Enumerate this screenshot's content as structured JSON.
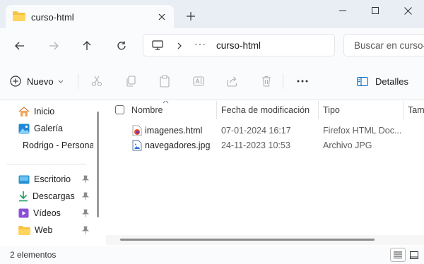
{
  "window": {
    "tab_title": "curso-html",
    "new_tab_symbol": "+"
  },
  "address": {
    "overflow": "···",
    "path": "curso-html"
  },
  "search": {
    "placeholder": "Buscar en curso-html"
  },
  "toolbar": {
    "new_label": "Nuevo",
    "details_label": "Detalles",
    "more": "···"
  },
  "sidebar": {
    "items": [
      {
        "label": "Inicio",
        "icon": "home-icon",
        "pinned": false
      },
      {
        "label": "Galería",
        "icon": "gallery-icon",
        "pinned": false
      },
      {
        "label": "Rodrigo - Personal",
        "icon": "onedrive-cloud-icon",
        "pinned": false
      },
      {
        "label": "Escritorio",
        "icon": "desktop-icon",
        "pinned": true
      },
      {
        "label": "Descargas",
        "icon": "download-icon",
        "pinned": true
      },
      {
        "label": "Vídeos",
        "icon": "videos-icon",
        "pinned": true
      },
      {
        "label": "Web",
        "icon": "folder-icon",
        "pinned": true
      }
    ]
  },
  "columns": {
    "name": "Nombre",
    "modified": "Fecha de modificación",
    "type": "Tipo",
    "size": "Tamaño"
  },
  "files": [
    {
      "name": "imagenes.html",
      "modified": "07-01-2024 16:17",
      "type": "Firefox HTML Doc...",
      "icon": "firefox-html-file-icon"
    },
    {
      "name": "navegadores.jpg",
      "modified": "24-11-2023 10:53",
      "type": "Archivo JPG",
      "icon": "image-file-icon"
    }
  ],
  "status": {
    "count": "2 elementos"
  },
  "colors": {
    "accent": "#0067c0",
    "folder": "#f6c342",
    "titlebar": "#e9eef5",
    "surface": "#f9fbfd"
  }
}
